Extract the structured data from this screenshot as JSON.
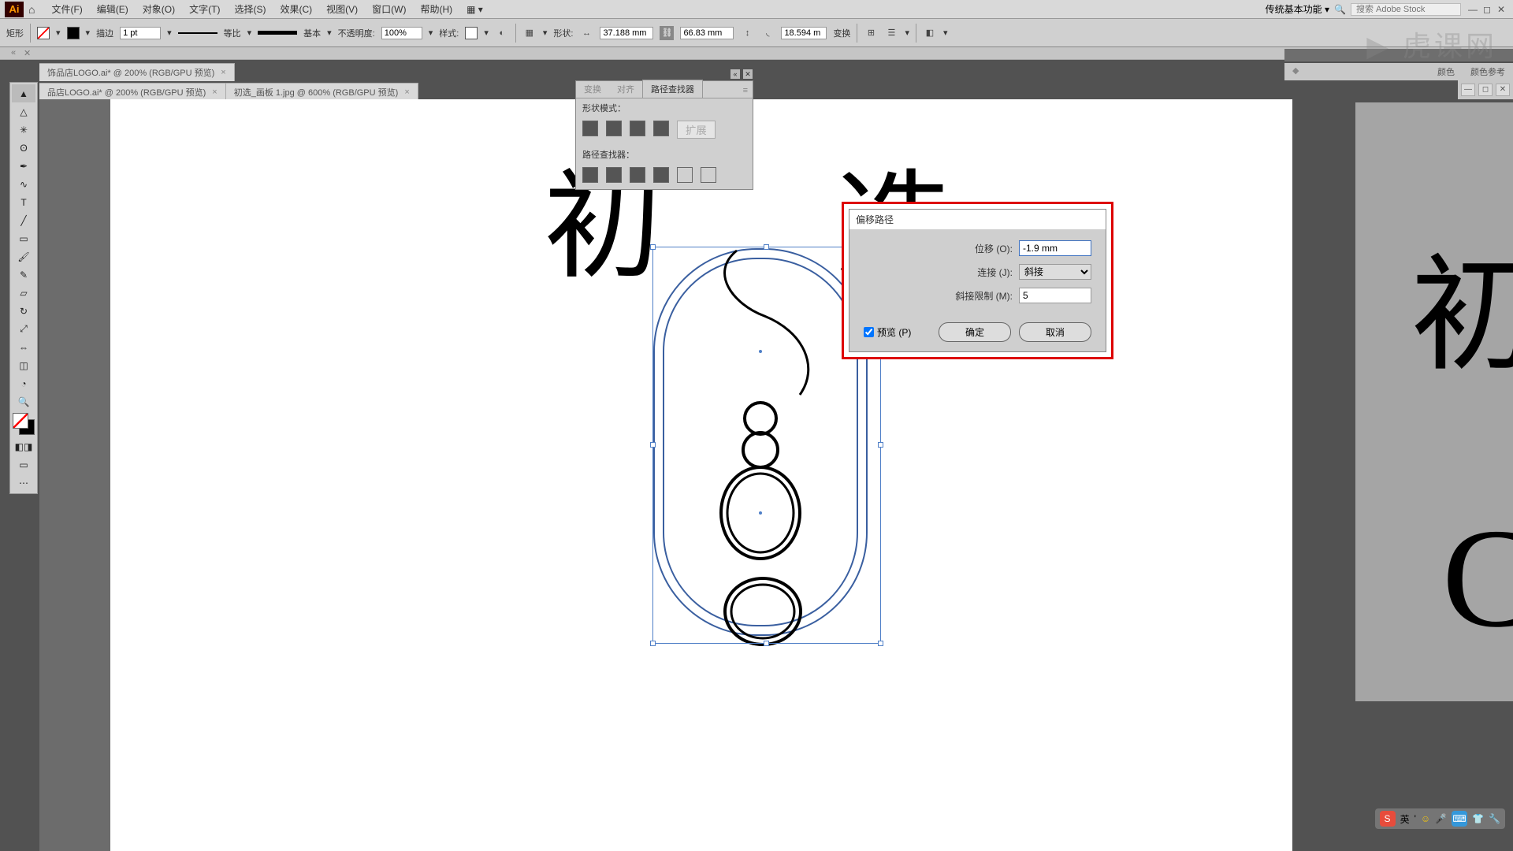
{
  "menubar": {
    "logo": "Ai",
    "items": [
      "文件(F)",
      "编辑(E)",
      "对象(O)",
      "文字(T)",
      "选择(S)",
      "效果(C)",
      "视图(V)",
      "窗口(W)",
      "帮助(H)"
    ],
    "workspace": "传统基本功能",
    "search_placeholder": "搜索 Adobe Stock"
  },
  "optbar": {
    "shape_label": "矩形",
    "stroke_label": "描边",
    "stroke_width": "1 pt",
    "profile_label": "等比",
    "cap_label": "基本",
    "opacity_label": "不透明度:",
    "opacity_value": "100%",
    "style_label": "样式:",
    "doc_label": "形状:",
    "width": "37.188 mm",
    "height": "66.83 mm",
    "radius": "18.594 m",
    "transform_btn": "变换"
  },
  "tabs": {
    "tab1": "饰品店LOGO.ai* @ 200% (RGB/GPU 预览)",
    "tab2": "品店LOGO.ai* @ 200% (RGB/GPU 预览)",
    "tab3": "初选_画板 1.jpg @ 600% (RGB/GPU 预览)"
  },
  "canvas": {
    "char1": "初",
    "char2": "选",
    "side_char1": "初",
    "side_char2": "C"
  },
  "pathfinder": {
    "tab_transform": "变换",
    "tab_align": "对齐",
    "tab_pathfinder": "路径查找器",
    "shape_modes": "形状模式：",
    "pathfinders": "路径查找器：",
    "expand": "扩展"
  },
  "right_panel": {
    "tab1": "颜色",
    "tab2": "颜色参考"
  },
  "dialog": {
    "title": "偏移路径",
    "offset_label": "位移 (O):",
    "offset_value": "-1.9 mm",
    "joins_label": "连接 (J):",
    "joins_value": "斜接",
    "miter_label": "斜接限制 (M):",
    "miter_value": "5",
    "preview": "预览 (P)",
    "ok": "确定",
    "cancel": "取消"
  },
  "watermark": "虎课网",
  "ime": {
    "mode": "英"
  }
}
